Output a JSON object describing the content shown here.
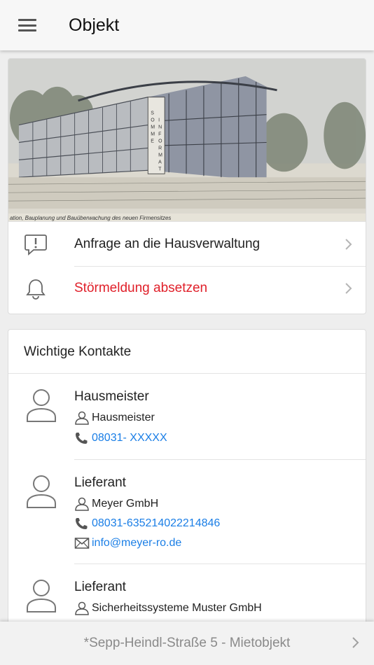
{
  "header": {
    "title": "Objekt",
    "menu_icon": "hamburger-menu-icon"
  },
  "hero": {
    "caption": "ation, Bauplanung und Bauüberwachung des neuen Firmensitzes",
    "sign_letters": "SOMME INFORMATIK"
  },
  "actions": [
    {
      "label": "Anfrage an die Hausverwaltung",
      "icon": "message-alert-icon",
      "color": "#222222"
    },
    {
      "label": "Störmeldung absetzen",
      "icon": "bell-icon",
      "color": "#e0202a"
    }
  ],
  "contacts_section": {
    "title": "Wichtige Kontakte",
    "items": [
      {
        "role": "Hausmeister",
        "name": "Hausmeister",
        "phone": "08031- XXXXX"
      },
      {
        "role": "Lieferant",
        "name": "Meyer GmbH",
        "phone": "08031-635214022214846",
        "email": "info@meyer-ro.de"
      },
      {
        "role": "Lieferant",
        "name": "Sicherheitssysteme Muster GmbH"
      }
    ]
  },
  "footer": {
    "property_label": "*Sepp-Heindl-Straße 5 - Mietobjekt"
  },
  "colors": {
    "accent_link": "#1a7ee6",
    "alert_red": "#e0202a"
  }
}
